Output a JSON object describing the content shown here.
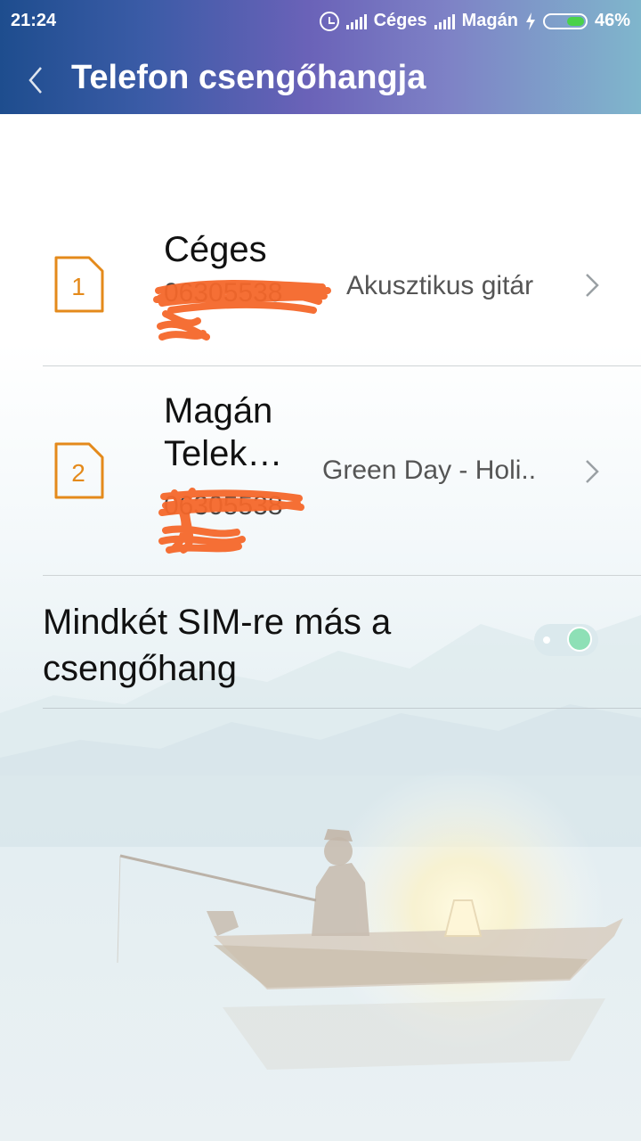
{
  "status_bar": {
    "time": "21:24",
    "carrier_1": "Céges",
    "carrier_2": "Magán",
    "battery_percent": "46%",
    "battery_level": 0.46,
    "icons": [
      "alarm-icon",
      "signal-icon",
      "signal-icon",
      "charging-icon",
      "battery-icon"
    ]
  },
  "header": {
    "title": "Telefon csengőhangja",
    "back_icon": "chevron-left-icon"
  },
  "sims": [
    {
      "slot": "1",
      "name": "Céges",
      "number": "06305538",
      "ringtone": "Akusztikus gitár"
    },
    {
      "slot": "2",
      "name": "Magán Telek…",
      "number": "06305538",
      "ringtone": "Green Day - Holi.."
    }
  ],
  "toggle": {
    "label": "Mindkét SIM-re más a csengőhang",
    "enabled": true
  },
  "colors": {
    "accent_orange": "#e48a1b",
    "scribble": "#f4672a",
    "toggle_on": "#8ee0b6"
  }
}
